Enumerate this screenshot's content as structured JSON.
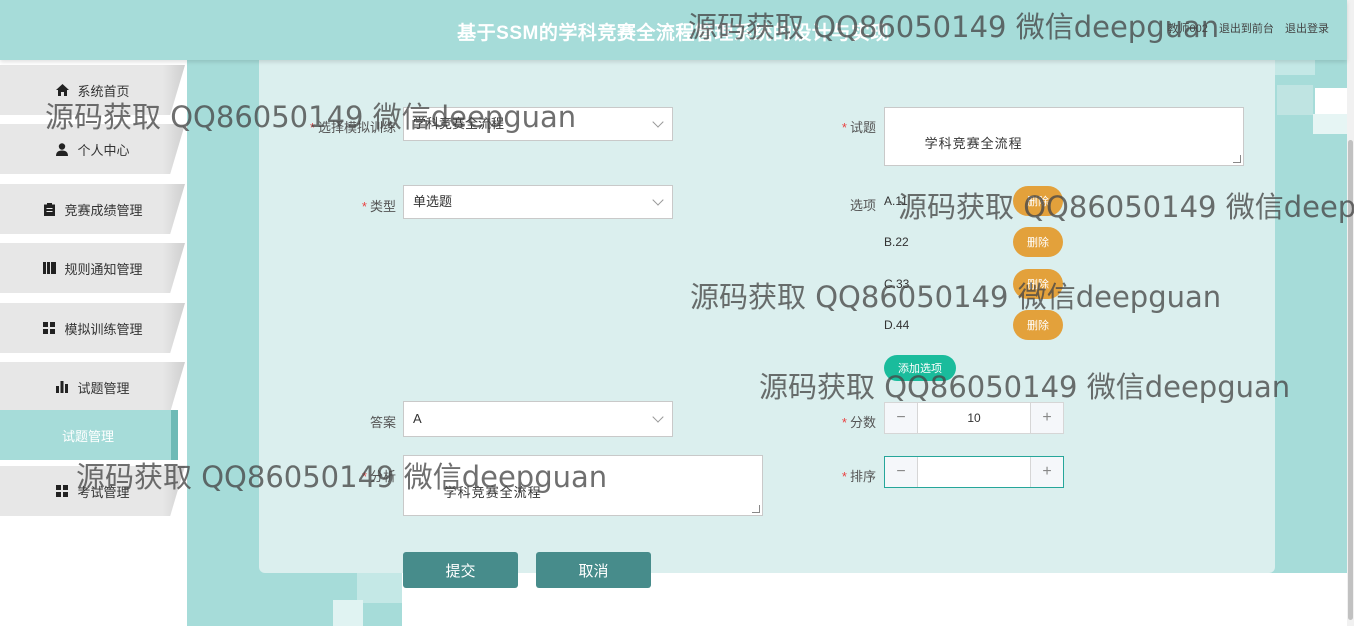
{
  "header": {
    "title": "基于SSM的学科竞赛全流程管理系统的设计与实现",
    "username": "教师002",
    "back_to_front": "退出到前台",
    "logout": "退出登录"
  },
  "sidebar": {
    "items": [
      {
        "label": "系统首页",
        "icon": "home-icon"
      },
      {
        "label": "个人中心",
        "icon": "user-icon"
      },
      {
        "label": "竞赛成绩管理",
        "icon": "clipboard-icon"
      },
      {
        "label": "规则通知管理",
        "icon": "books-icon"
      },
      {
        "label": "模拟训练管理",
        "icon": "grid-icon"
      },
      {
        "label": "试题管理",
        "icon": "bar-chart-icon"
      },
      {
        "label": "试题管理",
        "icon": ""
      },
      {
        "label": "考试管理",
        "icon": "grid-icon"
      }
    ]
  },
  "form": {
    "training": {
      "label": "选择模拟训练",
      "value": "学科竞赛全流程",
      "required": "*"
    },
    "question": {
      "label": "试题",
      "value": "学科竞赛全流程",
      "required": "*"
    },
    "type": {
      "label": "类型",
      "value": "单选题",
      "required": "*"
    },
    "options": {
      "label": "选项",
      "items": [
        {
          "text": "A.11",
          "delete": "删除"
        },
        {
          "text": "B.22",
          "delete": "删除"
        },
        {
          "text": "C.33",
          "delete": "删除"
        },
        {
          "text": "D.44",
          "delete": "删除"
        }
      ],
      "add": "添加选项"
    },
    "answer": {
      "label": "答案",
      "value": "A"
    },
    "score": {
      "label": "分数",
      "value": "10",
      "required": "*",
      "minus": "−",
      "plus": "+"
    },
    "analysis": {
      "label": "分析",
      "value": "学科竞赛全流程",
      "required": "*"
    },
    "order": {
      "label": "排序",
      "value": "",
      "required": "*",
      "minus": "−",
      "plus": "+"
    },
    "submit": "提交",
    "cancel": "取消"
  },
  "watermarks": [
    "源码获取 QQ86050149 微信deepguan",
    "源码获取 QQ86050149 微信deepguan",
    "源码获取 QQ86050149 微信deepguan",
    "源码获取 QQ86050149 微信deepguan",
    "源码获取 QQ86050149 微信deepguan",
    "源码获取 QQ86050149 微信deepguan"
  ],
  "colors": {
    "header": "#a6dcd9",
    "card": "#dbefee",
    "delete": "#e3a13b",
    "add": "#1abc9c",
    "action": "#478c8b"
  }
}
